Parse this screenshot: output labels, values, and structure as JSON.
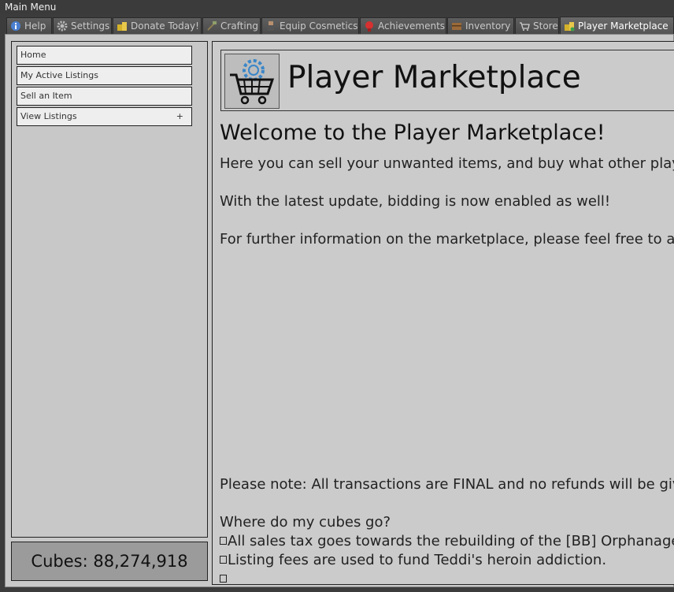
{
  "window": {
    "title": "Main Menu"
  },
  "tabs": [
    {
      "label": "Help",
      "icon": "info-icon"
    },
    {
      "label": "Settings",
      "icon": "gear-icon"
    },
    {
      "label": "Donate Today!",
      "icon": "coins-icon"
    },
    {
      "label": "Crafting",
      "icon": "hammer-icon"
    },
    {
      "label": "Equip Cosmetics",
      "icon": "character-icon"
    },
    {
      "label": "Achievements",
      "icon": "ribbon-icon"
    },
    {
      "label": "Inventory",
      "icon": "chest-icon"
    },
    {
      "label": "Store",
      "icon": "cart-icon"
    },
    {
      "label": "Player Marketplace",
      "icon": "coins-icon",
      "active": true
    }
  ],
  "sidebar": {
    "items": [
      {
        "label": "Home"
      },
      {
        "label": "My Active Listings"
      },
      {
        "label": "Sell an Item"
      },
      {
        "label": "View Listings",
        "expand": "+"
      }
    ],
    "cubes": "Cubes: 88,274,918"
  },
  "main": {
    "title": "Player Marketplace",
    "welcome": "Welcome to the Player Marketplace!",
    "paragraphs": [
      "Here you can sell your unwanted items, and buy what other players have listed!",
      "With the latest update, bidding is now enabled as well!",
      "For further information on the marketplace, please feel free to ask staff!"
    ],
    "note": "Please note: All transactions are FINAL and no refunds will be given.",
    "cubes_heading": "Where do my cubes go?",
    "bullets": [
      "All sales tax goes towards the rebuilding of the [BB] Orphanage.",
      "Listing fees are used to fund Teddi's heroin addiction."
    ]
  }
}
